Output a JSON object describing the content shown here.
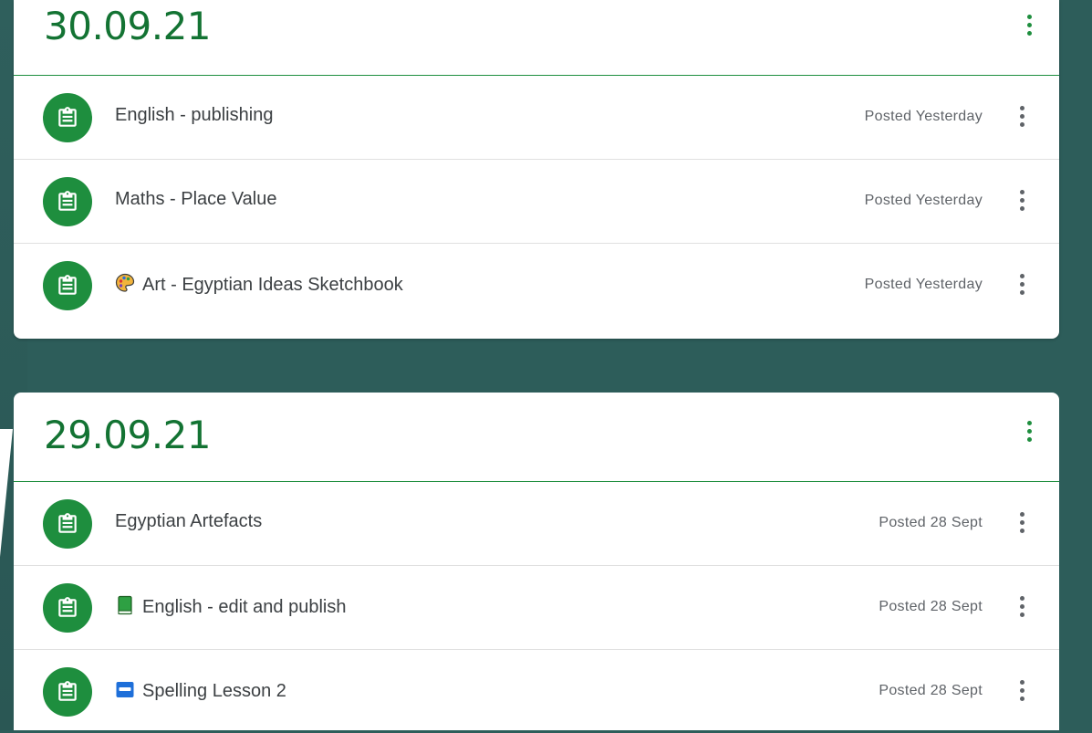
{
  "topics": [
    {
      "title": "30.09.21",
      "items": [
        {
          "title": "English - publishing",
          "posted": "Posted Yesterday"
        },
        {
          "title": "Maths - Place Value",
          "posted": "Posted Yesterday"
        },
        {
          "title": "Art - Egyptian Ideas Sketchbook",
          "posted": "Posted Yesterday",
          "emoji": "palette-icon"
        }
      ]
    },
    {
      "title": "29.09.21",
      "items": [
        {
          "title": "Egyptian Artefacts",
          "posted": "Posted 28 Sept"
        },
        {
          "title": "English - edit and publish",
          "posted": "Posted 28 Sept",
          "emoji": "green-book-icon"
        },
        {
          "title": "Spelling Lesson 2",
          "posted": "Posted 28 Sept",
          "emoji": "abc-icon"
        }
      ]
    }
  ],
  "colors": {
    "accent": "#1e8e3e",
    "title": "#137333",
    "background": "#2d5d5a"
  }
}
